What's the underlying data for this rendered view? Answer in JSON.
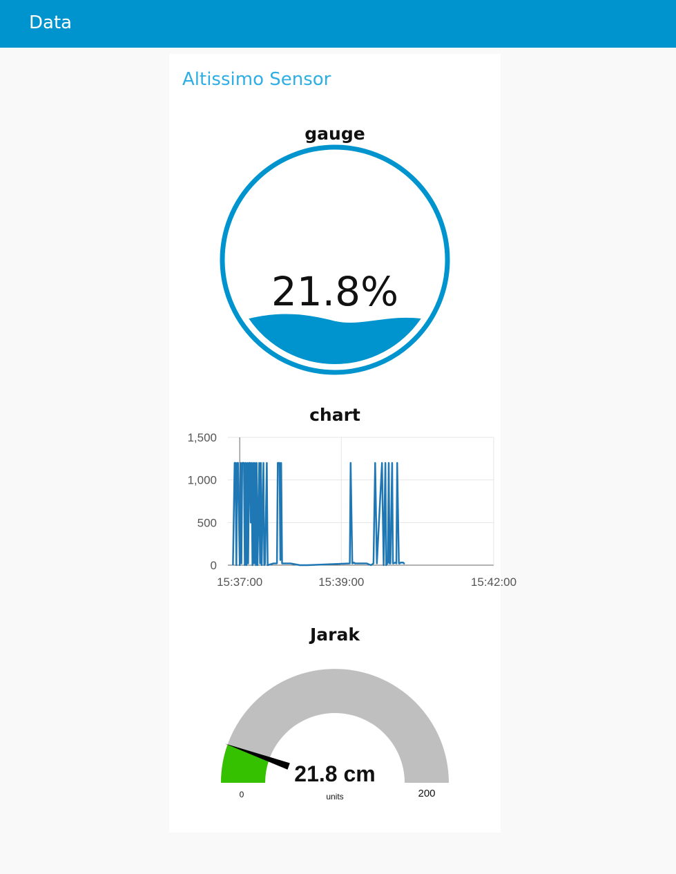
{
  "header": {
    "title": "Data"
  },
  "group": {
    "title": "Altissimo Sensor"
  },
  "level_gauge": {
    "label": "gauge",
    "value_text": "21.8%",
    "level_percent": 21.8,
    "color": "#0094ce"
  },
  "chart": {
    "label": "chart",
    "line_color": "#1f77b4"
  },
  "chart_data": {
    "type": "line",
    "title": "chart",
    "xlabel": "",
    "ylabel": "",
    "ylim": [
      0,
      1500
    ],
    "yticks": [
      "1,500",
      "1,000",
      "500",
      "0"
    ],
    "xticks": [
      "15:37:00",
      "15:39:00",
      "15:42:00"
    ],
    "grid": true,
    "x_unit": "seconds after 15:37:00",
    "series": [
      {
        "x": [
          -8,
          -6,
          -5,
          -4,
          -3,
          -2,
          0,
          1,
          2,
          3,
          5,
          6,
          7,
          8,
          9,
          10,
          11,
          12,
          13,
          14,
          15,
          16,
          17,
          18,
          19,
          20,
          21,
          22,
          23,
          24,
          25,
          26,
          28,
          29,
          30,
          32,
          33,
          40,
          44,
          45,
          47,
          48,
          49,
          50,
          51,
          53,
          56,
          60,
          71,
          72,
          75,
          78,
          80,
          130,
          131,
          133,
          135,
          136,
          150,
          155,
          158,
          160,
          162,
          168,
          170,
          172,
          173,
          175,
          176,
          177,
          178,
          180,
          181,
          184,
          185,
          186,
          188,
          189,
          190,
          191,
          193,
          194,
          195
        ],
        "y": [
          0,
          1200,
          1200,
          0,
          1200,
          1200,
          0,
          1200,
          20,
          1200,
          1200,
          0,
          1200,
          0,
          1200,
          20,
          1200,
          1200,
          500,
          1200,
          0,
          1200,
          20,
          1200,
          0,
          1200,
          0,
          500,
          1200,
          20,
          1200,
          0,
          1200,
          0,
          20,
          1200,
          0,
          20,
          20,
          1200,
          1200,
          60,
          1200,
          20,
          20,
          20,
          20,
          20,
          0,
          0,
          0,
          0,
          0,
          20,
          1200,
          20,
          30,
          20,
          20,
          0,
          20,
          1200,
          20,
          1200,
          0,
          1200,
          0,
          30,
          1200,
          20,
          20,
          1200,
          20,
          30,
          20,
          1200,
          20,
          20,
          30,
          30,
          30,
          20,
          20
        ]
      }
    ]
  },
  "distance_gauge": {
    "label": "Jarak",
    "value_text": "21.8 cm",
    "units_label": "units",
    "min_label": "0",
    "max_label": "200",
    "min": 0,
    "max": 200,
    "value": 21.8,
    "fill_color": "#35c000",
    "track_color": "#bfbfbf",
    "needle_color": "#000000"
  }
}
